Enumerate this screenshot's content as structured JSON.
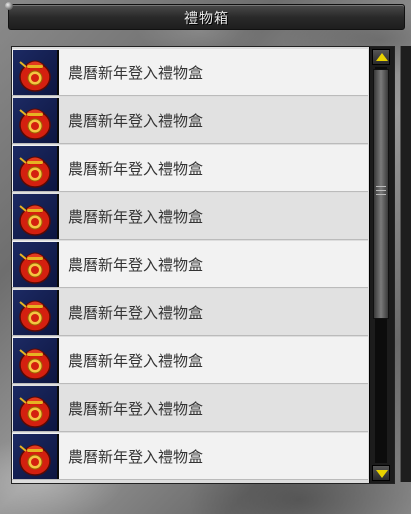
{
  "window": {
    "title": "禮物箱"
  },
  "gift_list": {
    "items": [
      {
        "name": "農曆新年登入禮物盒",
        "icon": "red-gift-pouch-icon"
      },
      {
        "name": "農曆新年登入禮物盒",
        "icon": "red-gift-pouch-icon"
      },
      {
        "name": "農曆新年登入禮物盒",
        "icon": "red-gift-pouch-icon"
      },
      {
        "name": "農曆新年登入禮物盒",
        "icon": "red-gift-pouch-icon"
      },
      {
        "name": "農曆新年登入禮物盒",
        "icon": "red-gift-pouch-icon"
      },
      {
        "name": "農曆新年登入禮物盒",
        "icon": "red-gift-pouch-icon"
      },
      {
        "name": "農曆新年登入禮物盒",
        "icon": "red-gift-pouch-icon"
      },
      {
        "name": "農曆新年登入禮物盒",
        "icon": "red-gift-pouch-icon"
      },
      {
        "name": "農曆新年登入禮物盒",
        "icon": "red-gift-pouch-icon"
      }
    ]
  },
  "colors": {
    "scroll_arrow": "#e8d200",
    "icon_bg": "#1c2a63",
    "pouch_red": "#d4200f"
  }
}
